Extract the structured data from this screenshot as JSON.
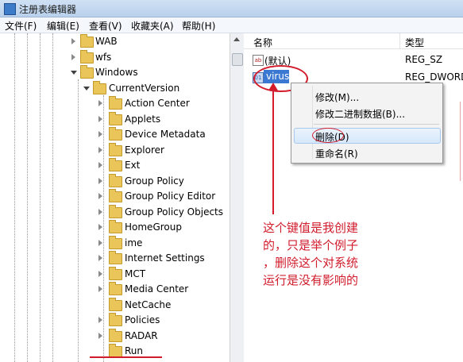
{
  "window": {
    "title": "注册表编辑器"
  },
  "menu": [
    "文件(F)",
    "编辑(E)",
    "查看(V)",
    "收藏夹(A)",
    "帮助(H)"
  ],
  "tree": {
    "top_nodes": [
      "WAB",
      "wfs",
      "Windows"
    ],
    "current_version": "CurrentVersion",
    "children": [
      "Action Center",
      "Applets",
      "Device Metadata",
      "Explorer",
      "Ext",
      "Group Policy",
      "Group Policy Editor",
      "Group Policy Objects",
      "HomeGroup",
      "ime",
      "Internet Settings",
      "MCT",
      "Media Center",
      "NetCache",
      "Policies",
      "RADAR",
      "Run"
    ]
  },
  "values_pane": {
    "headers": {
      "name": "名称",
      "type": "类型"
    },
    "rows": [
      {
        "name": "(默认)",
        "type": "REG_SZ",
        "icon": "string-value-icon"
      },
      {
        "name": "virus",
        "type": "REG_DWORD",
        "icon": "dword-value-icon"
      }
    ]
  },
  "context_menu": {
    "items": [
      "修改(M)...",
      "修改二进制数据(B)...",
      "删除(D)",
      "重命名(R)"
    ],
    "highlighted": "删除(D)"
  },
  "annotation": {
    "lines": [
      "这个键值是我创建",
      "的，只是举个例子",
      "，删除这个对系统",
      "运行是没有影响的"
    ]
  },
  "colors": {
    "annotation_red": "#d21c2c",
    "selection_blue": "#3a78d2",
    "folder_yellow": "#e9c55a"
  }
}
